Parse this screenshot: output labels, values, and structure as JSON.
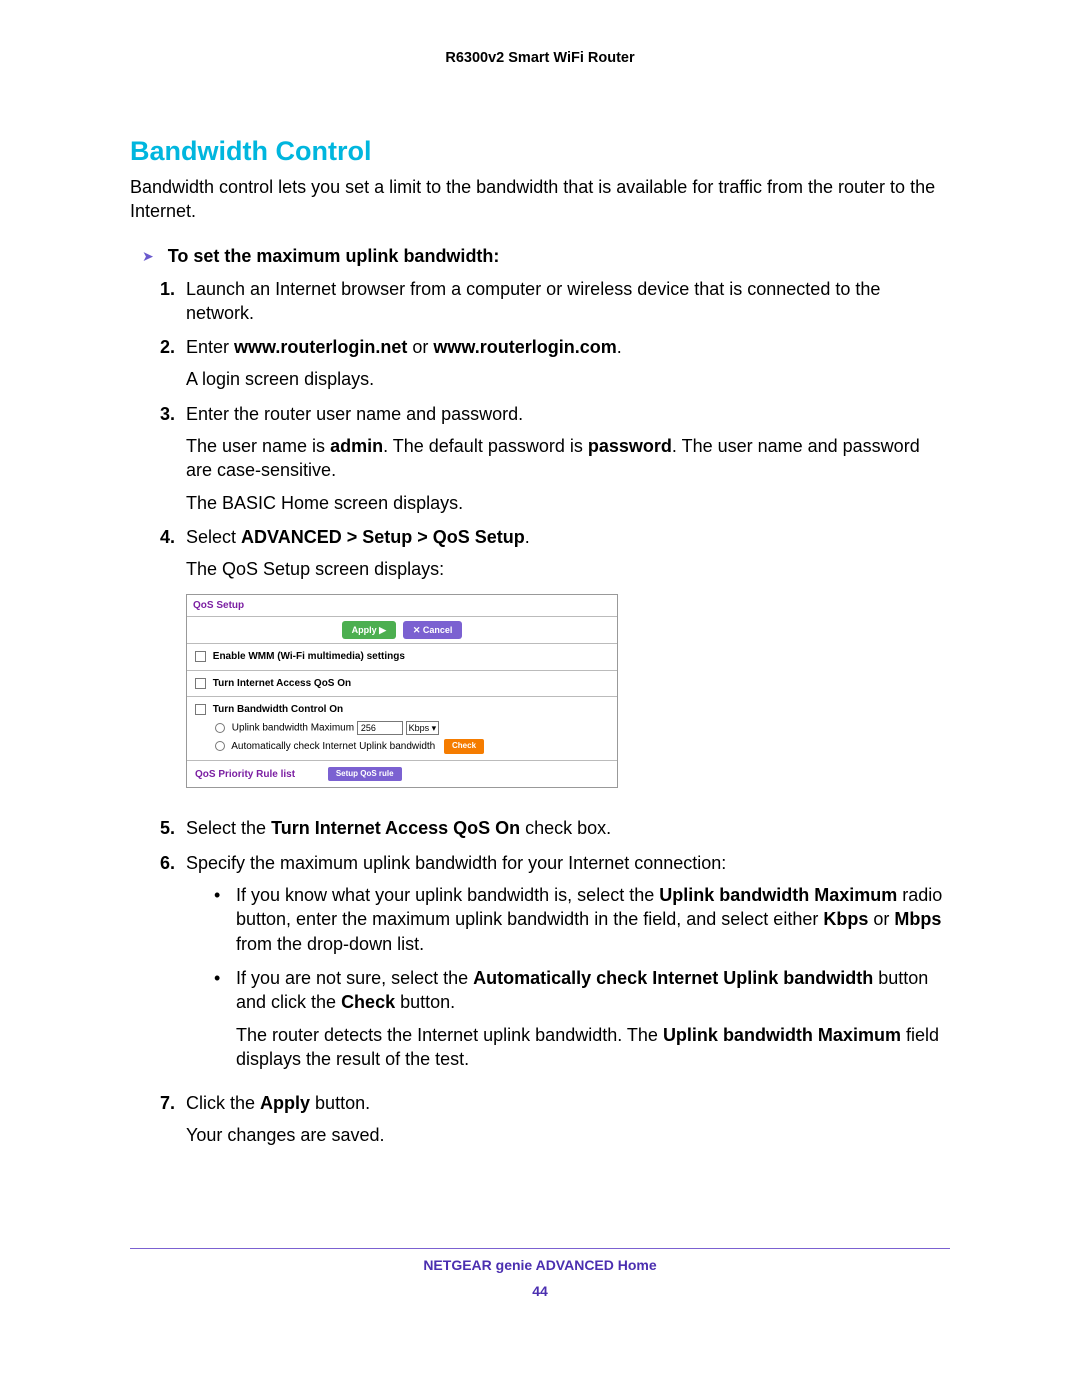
{
  "header": {
    "product": "R6300v2 Smart WiFi Router"
  },
  "section": {
    "title": "Bandwidth Control"
  },
  "intro": "Bandwidth control lets you set a limit to the bandwidth that is available for traffic from the router to the Internet.",
  "task": {
    "arrow": "➤",
    "title": "To set the maximum uplink bandwidth:"
  },
  "steps": {
    "s1": {
      "num": "1.",
      "text": "Launch an Internet browser from a computer or wireless device that is connected to the network."
    },
    "s2": {
      "num": "2.",
      "pre": "Enter ",
      "b1": "www.routerlogin.net",
      "mid": " or ",
      "b2": "www.routerlogin.com",
      "post": ".",
      "sub": "A login screen displays."
    },
    "s3": {
      "num": "3.",
      "text": "Enter the router user name and password.",
      "sub1a": "The user name is ",
      "sub1b": "admin",
      "sub1c": ". The default password is ",
      "sub1d": "password",
      "sub1e": ". The user name and password are case-sensitive.",
      "sub2": "The BASIC Home screen displays."
    },
    "s4": {
      "num": "4.",
      "pre": "Select ",
      "b": "ADVANCED > Setup > QoS Setup",
      "post": ".",
      "sub": "The QoS Setup screen displays:"
    },
    "s5": {
      "num": "5.",
      "pre": "Select the ",
      "b": "Turn Internet Access QoS On",
      "post": " check box."
    },
    "s6": {
      "num": "6.",
      "text": "Specify the maximum uplink bandwidth for your Internet connection:",
      "b1a": "If you know what your uplink bandwidth is, select the ",
      "b1b": "Uplink bandwidth Maximum",
      "b1c": " radio button, enter the maximum uplink bandwidth in the field, and select either ",
      "b1d": "Kbps",
      "b1e": " or ",
      "b1f": "Mbps",
      "b1g": " from the drop-down list.",
      "b2a": "If you are not sure, select the ",
      "b2b": "Automatically check Internet Uplink bandwidth",
      "b2c": " button and click the ",
      "b2d": "Check",
      "b2e": " button.",
      "b2sub_a": "The router detects the Internet uplink bandwidth. The ",
      "b2sub_b": "Uplink bandwidth Maximum",
      "b2sub_c": " field displays the result of the test."
    },
    "s7": {
      "num": "7.",
      "pre": "Click the ",
      "b": "Apply",
      "post": " button.",
      "sub": "Your changes are saved."
    }
  },
  "figure": {
    "title": "QoS Setup",
    "apply": "Apply ▶",
    "cancel": "✕ Cancel",
    "row1": "Enable WMM (Wi-Fi multimedia) settings",
    "row2": "Turn Internet Access QoS On",
    "row3": "Turn Bandwidth Control On",
    "uplink_label": "Uplink bandwidth Maximum",
    "uplink_value": "256",
    "uplink_unit": "Kbps   ▾",
    "auto_label": "Automatically check Internet Uplink bandwidth",
    "check": "Check",
    "rule_label": "QoS Priority Rule list",
    "setup_rule": "Setup QoS rule"
  },
  "footer": {
    "text": "NETGEAR genie ADVANCED Home",
    "page": "44"
  }
}
